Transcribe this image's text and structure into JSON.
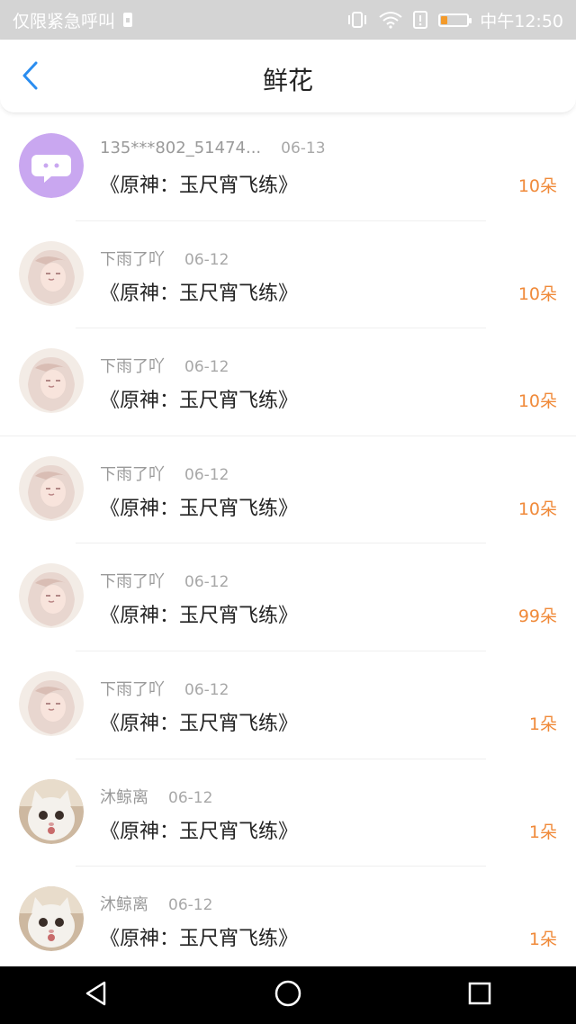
{
  "status_bar": {
    "left_text": "仅限紧急呼叫",
    "time": "中午12:50",
    "icons": [
      "sim-lock-icon",
      "vibrate-icon",
      "wifi-icon",
      "alert-icon",
      "battery-icon"
    ],
    "battery_level": 0.2,
    "battery_color": "#f39a2a"
  },
  "header": {
    "back_icon": "chevron-left-icon",
    "title": "鲜花"
  },
  "items": [
    {
      "name": "135***802_51474...",
      "date": "06-13",
      "work": "《原神：玉尺宵飞练》",
      "count": "10朵",
      "avatar": "chat-bubble-avatar"
    },
    {
      "name": "下雨了吖",
      "date": "06-12",
      "work": "《原神：玉尺宵飞练》",
      "count": "10朵",
      "avatar": "anime-girl-avatar"
    },
    {
      "name": "下雨了吖",
      "date": "06-12",
      "work": "《原神：玉尺宵飞练》",
      "count": "10朵",
      "avatar": "anime-girl-avatar"
    },
    {
      "name": "下雨了吖",
      "date": "06-12",
      "work": "《原神：玉尺宵飞练》",
      "count": "10朵",
      "avatar": "anime-girl-avatar"
    },
    {
      "name": "下雨了吖",
      "date": "06-12",
      "work": "《原神：玉尺宵飞练》",
      "count": "99朵",
      "avatar": "anime-girl-avatar"
    },
    {
      "name": "下雨了吖",
      "date": "06-12",
      "work": "《原神：玉尺宵飞练》",
      "count": "1朵",
      "avatar": "anime-girl-avatar"
    },
    {
      "name": "沐鲸离",
      "date": "06-12",
      "work": "《原神：玉尺宵飞练》",
      "count": "1朵",
      "avatar": "cat-avatar"
    },
    {
      "name": "沐鲸离",
      "date": "06-12",
      "work": "《原神：玉尺宵飞练》",
      "count": "1朵",
      "avatar": "cat-avatar"
    }
  ],
  "colors": {
    "accent_blue": "#2a8df0",
    "count_orange": "#f08a3a",
    "avatar_purple": "#c9a7f0"
  },
  "nav_bar": {
    "icons": [
      "back-triangle-icon",
      "home-circle-icon",
      "recents-square-icon"
    ]
  }
}
